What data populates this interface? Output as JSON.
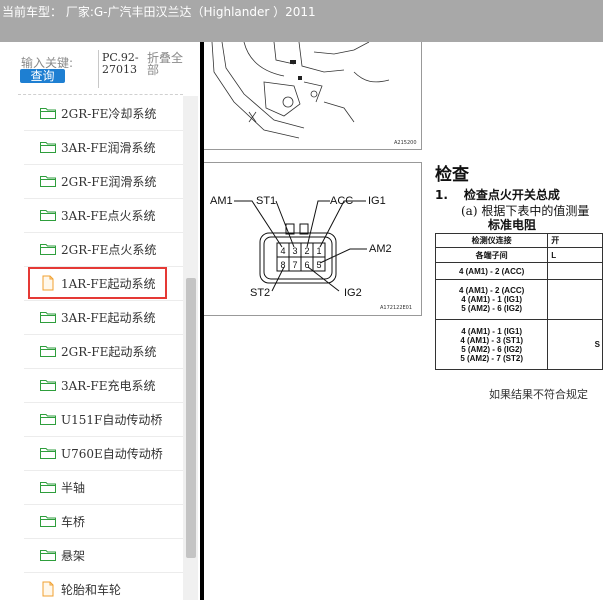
{
  "header": {
    "title": "当前车型： 厂家:G-广汽丰田汉兰达（Highlander ）2011"
  },
  "sidebar": {
    "search_label": "输入关键:",
    "query_button": "查询",
    "search_value": "PC.92-27013",
    "collapse_all": "折叠全部",
    "items": [
      {
        "label": "2GR-FE冷却系统",
        "icon": "folder-green-icon"
      },
      {
        "label": "3AR-FE润滑系统",
        "icon": "folder-green-icon"
      },
      {
        "label": "2GR-FE润滑系统",
        "icon": "folder-green-icon"
      },
      {
        "label": "3AR-FE点火系统",
        "icon": "folder-green-icon"
      },
      {
        "label": "2GR-FE点火系统",
        "icon": "folder-green-icon"
      },
      {
        "label": "1AR-FE起动系统",
        "icon": "document-icon",
        "selected": true
      },
      {
        "label": "3AR-FE起动系统",
        "icon": "folder-green-icon"
      },
      {
        "label": "2GR-FE起动系统",
        "icon": "folder-green-icon"
      },
      {
        "label": "3AR-FE充电系统",
        "icon": "folder-green-icon"
      },
      {
        "label": "U151F自动传动桥",
        "icon": "folder-green-icon"
      },
      {
        "label": "U760E自动传动桥",
        "icon": "folder-green-icon"
      },
      {
        "label": "半轴",
        "icon": "folder-green-icon"
      },
      {
        "label": "车桥",
        "icon": "folder-green-icon"
      },
      {
        "label": "悬架",
        "icon": "folder-green-icon"
      },
      {
        "label": "轮胎和车轮",
        "icon": "document-icon"
      }
    ]
  },
  "document": {
    "figure1_code": "A215200",
    "figure2_code": "A172122E01",
    "connector_labels": {
      "am1": "AM1",
      "st1": "ST1",
      "acc": "ACC",
      "ig1": "IG1",
      "am2": "AM2",
      "st2": "ST2",
      "ig2": "IG2"
    },
    "pins_top": [
      "4",
      "3",
      "2",
      "1"
    ],
    "pins_bottom": [
      "8",
      "7",
      "6",
      "5"
    ],
    "section_title": "检查",
    "step1_num": "1.",
    "step1_text": "检查点火开关总成",
    "step_a": "(a)  根据下表中的值测量",
    "standard_resistance": "标准电阻",
    "table": {
      "header_col1": "检测仪连接",
      "header_col2": "开",
      "sub_col1": "各端子间",
      "sub_col2": "L",
      "rows": [
        {
          "lines": [
            "4 (AM1) - 2 (ACC)"
          ],
          "value": ""
        },
        {
          "lines": [
            "4 (AM1) - 2 (ACC)",
            "4 (AM1) - 1 (IG1)",
            "5 (AM2) - 6 (IG2)"
          ],
          "value": ""
        },
        {
          "lines": [
            "4 (AM1) - 1 (IG1)",
            "4 (AM1) - 3 (ST1)",
            "5 (AM2) - 6 (IG2)",
            "5 (AM2) - 7 (ST2)"
          ],
          "value": "S"
        }
      ]
    },
    "note": "如果结果不符合规定"
  },
  "colors": {
    "topbar": "#a8a8a8",
    "query_button": "#1e7fd2",
    "selected_border": "#e53935",
    "folder_green": "#2e9e3c",
    "document_orange": "#f0a030"
  }
}
